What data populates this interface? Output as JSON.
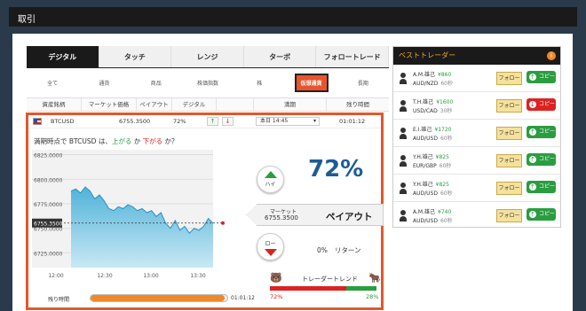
{
  "window": {
    "title": "取引"
  },
  "tabs": [
    "デジタル",
    "タッチ",
    "レンジ",
    "ターボ",
    "フォロートレード"
  ],
  "subnav": [
    "全て",
    "通貨",
    "商品",
    "株価指数",
    "株",
    "仮想通貨",
    "長期"
  ],
  "columns": [
    "資産銘柄",
    "マーケット価格",
    "ペイアウト",
    "デジタル",
    "",
    "満期",
    "残り時間"
  ],
  "asset": {
    "symbol": "BTCUSD",
    "price": "6755.3500",
    "payout_pct": "72%",
    "expiry_select": "本日 14:45",
    "remaining": "01:01:12"
  },
  "prompt": {
    "prefix": "満期時点で BTCUSD は、",
    "up": "上がる",
    "mid": " か ",
    "down": "下がる",
    "suffix": " か？"
  },
  "hi_label": "ハイ",
  "lo_label": "ロー",
  "big_payout": "72%",
  "market_label": "マーケット",
  "market_value": "6755.3500",
  "payout_label": "ペイアウト",
  "return_pct": "0%",
  "return_label": "リターン",
  "remaining_label": "残り時間",
  "remaining_time": "01:01:12",
  "remaining_progress": 0.98,
  "trend": {
    "label": "トレーダートレンド",
    "bear_pct": "72%",
    "bull_pct": "28%",
    "bear_value": 72,
    "bull_value": 28
  },
  "colors": {
    "accent": "#e2572c",
    "up": "#2a9d40",
    "down": "#dd2222",
    "payout": "#1d5c97",
    "progress": "#f08a27"
  },
  "chart_data": {
    "type": "area",
    "yticks": [
      "6825.0000",
      "6800.0000",
      "6775.0000",
      "6750.0000",
      "6725.0000"
    ],
    "xticks": [
      "12:00",
      "12:30",
      "13:00",
      "13:30"
    ],
    "current_label": "6755.3500",
    "ylim": [
      6710,
      6830
    ],
    "x": [
      "11:42",
      "11:46",
      "11:50",
      "11:54",
      "11:58",
      "12:02",
      "12:06",
      "12:10",
      "12:14",
      "12:18",
      "12:22",
      "12:26",
      "12:30",
      "12:34",
      "12:38",
      "12:42",
      "12:46",
      "12:50",
      "12:54",
      "12:58",
      "13:02",
      "13:06",
      "13:10",
      "13:14",
      "13:18",
      "13:22",
      "13:26",
      "13:30",
      "13:34",
      "13:38",
      "13:42"
    ],
    "y": [
      6788,
      6790,
      6786,
      6792,
      6788,
      6780,
      6784,
      6778,
      6770,
      6768,
      6772,
      6770,
      6774,
      6772,
      6768,
      6770,
      6766,
      6768,
      6762,
      6766,
      6755,
      6750,
      6758,
      6748,
      6752,
      6745,
      6750,
      6748,
      6752,
      6760,
      6755
    ]
  },
  "best_traders": {
    "title": "ベストトレーダー",
    "info_icon": "i",
    "follow_label": "フォロー",
    "copy_label": "コピー",
    "items": [
      {
        "name": "A.M.雄己",
        "amount": "¥860",
        "pair": "AUD/NZD",
        "secs": "60秒",
        "direction": "up"
      },
      {
        "name": "T.H.雄己",
        "amount": "¥1600",
        "pair": "USD/CAD",
        "secs": "30秒",
        "direction": "down"
      },
      {
        "name": "E.I.雄己",
        "amount": "¥1720",
        "pair": "AUD/USD",
        "secs": "60秒",
        "direction": "up"
      },
      {
        "name": "Y.H.雄己",
        "amount": "¥825",
        "pair": "EUR/GBP",
        "secs": "60秒",
        "direction": "up"
      },
      {
        "name": "Y.H.雄己",
        "amount": "¥825",
        "pair": "AUD/USD",
        "secs": "60秒",
        "direction": "up"
      },
      {
        "name": "A.M.雄己",
        "amount": "¥740",
        "pair": "AUD/USD",
        "secs": "60秒",
        "direction": "up"
      }
    ]
  }
}
